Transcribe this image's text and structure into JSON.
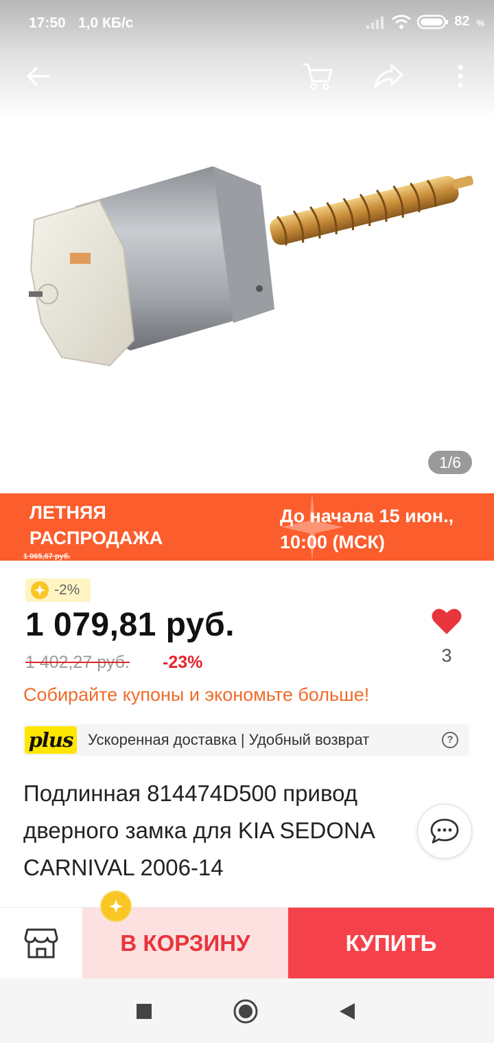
{
  "status_bar": {
    "time": "17:50",
    "network_speed": "1,0 КБ/с",
    "battery": "82",
    "battery_unit": "%"
  },
  "nav": {
    "back_icon": "arrow-left-icon",
    "cart_icon": "cart-icon",
    "share_icon": "share-icon",
    "more_icon": "more-vertical-icon"
  },
  "gallery": {
    "counter": "1/6"
  },
  "promo": {
    "title": "ЛЕТНЯЯ РАСПРОДАЖА",
    "small_price": "1 065,67 руб.",
    "timer": "До начала 15 июн., 10:00 (МСК)",
    "color": "#fb5d2c"
  },
  "price": {
    "coin_discount": "-2%",
    "current": "1 079,81 руб.",
    "old": "1 402,27 руб.",
    "discount": "-23%",
    "coupon_text": "Собирайте купоны и экономьте больше!"
  },
  "wishlist": {
    "count": "3",
    "color": "#e8343b"
  },
  "plus": {
    "logo": "plus",
    "text": "Ускоренная доставка | Удобный возврат",
    "help": "?"
  },
  "product": {
    "title": "Подлинная 814474D500 привод дверного замка для KIA SEDONA CARNIVAL 2006-14"
  },
  "actions": {
    "add_to_cart": "В КОРЗИНУ",
    "buy": "КУПИТЬ",
    "cart_bg": "#fde0e0",
    "buy_bg": "#f5424a"
  }
}
